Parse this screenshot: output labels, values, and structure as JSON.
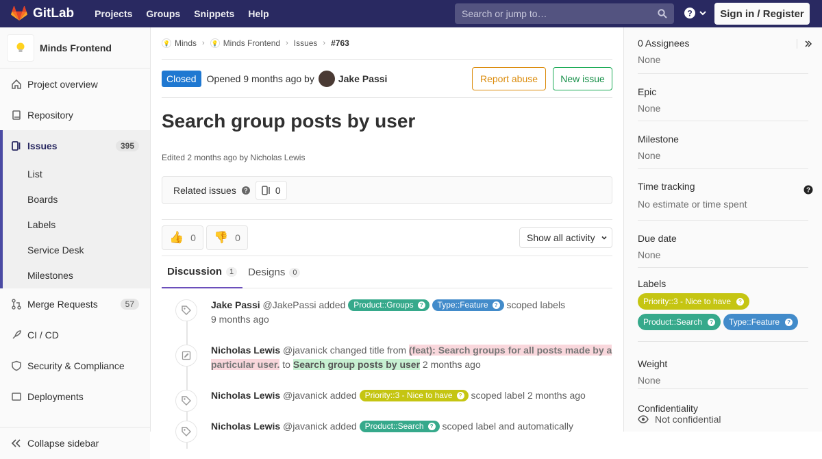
{
  "topbar": {
    "brand": "GitLab",
    "nav": [
      "Projects",
      "Groups",
      "Snippets",
      "Help"
    ],
    "search_placeholder": "Search or jump to…",
    "signin_label": "Sign in / Register"
  },
  "sidebar": {
    "project_name": "Minds Frontend",
    "items": [
      {
        "label": "Project overview",
        "icon": "home-icon"
      },
      {
        "label": "Repository",
        "icon": "book-icon"
      },
      {
        "label": "Issues",
        "icon": "issues-icon",
        "count": "395"
      },
      {
        "label": "Merge Requests",
        "icon": "merge-icon",
        "count": "57"
      },
      {
        "label": "CI / CD",
        "icon": "rocket-icon"
      },
      {
        "label": "Security & Compliance",
        "icon": "shield-icon"
      },
      {
        "label": "Deployments",
        "icon": "deploy-icon"
      }
    ],
    "issue_subitems": [
      "List",
      "Boards",
      "Labels",
      "Service Desk",
      "Milestones"
    ],
    "collapse_label": "Collapse sidebar"
  },
  "breadcrumb": {
    "items": [
      "Minds",
      "Minds Frontend",
      "Issues"
    ],
    "current": "#763"
  },
  "issue": {
    "status": "Closed",
    "opened_text": "Opened 9 months ago by",
    "author": "Jake Passi",
    "report_label": "Report abuse",
    "new_issue_label": "New issue",
    "title": "Search group posts by user",
    "edited_text": "Edited 2 months ago by Nicholas Lewis",
    "related_label": "Related issues",
    "related_count": "0",
    "thumbs_up": "0",
    "thumbs_down": "0",
    "activity_filter": "Show all activity"
  },
  "tabs": [
    {
      "label": "Discussion",
      "count": "1"
    },
    {
      "label": "Designs",
      "count": "0"
    }
  ],
  "notes": [
    {
      "name": "Jake Passi",
      "handle": "@JakePassi",
      "action": "added",
      "labels": [
        "Product::Groups",
        "Type::Feature"
      ],
      "suffix": "scoped labels",
      "time": "9 months ago"
    },
    {
      "name": "Nicholas Lewis",
      "handle": "@javanick",
      "action": "changed title from",
      "old_title": "(feat): Search groups for all posts made by a particular user.",
      "to": "to",
      "new_title": "Search group posts by user",
      "time": "2 months ago"
    },
    {
      "name": "Nicholas Lewis",
      "handle": "@javanick",
      "action": "added",
      "labels": [
        "Priority::3 - Nice to have"
      ],
      "suffix": "scoped label 2 months ago"
    },
    {
      "name": "Nicholas Lewis",
      "handle": "@javanick",
      "action": "added",
      "labels": [
        "Product::Search"
      ],
      "suffix": "scoped label and automatically"
    }
  ],
  "right_sidebar": {
    "assignees_title": "0 Assignees",
    "assignees_value": "None",
    "epic_title": "Epic",
    "epic_value": "None",
    "milestone_title": "Milestone",
    "milestone_value": "None",
    "time_title": "Time tracking",
    "time_value": "No estimate or time spent",
    "due_title": "Due date",
    "due_value": "None",
    "labels_title": "Labels",
    "labels": [
      "Priority::3 - Nice to have",
      "Product::Search",
      "Type::Feature"
    ],
    "weight_title": "Weight",
    "weight_value": "None",
    "conf_title": "Confidentiality",
    "conf_value": "Not confidential"
  },
  "colors": {
    "topbar": "#292961",
    "closed": "#1f78d1",
    "product_label": "#36a98b",
    "type_label": "#428bca",
    "priority_label": "#c5c512"
  }
}
